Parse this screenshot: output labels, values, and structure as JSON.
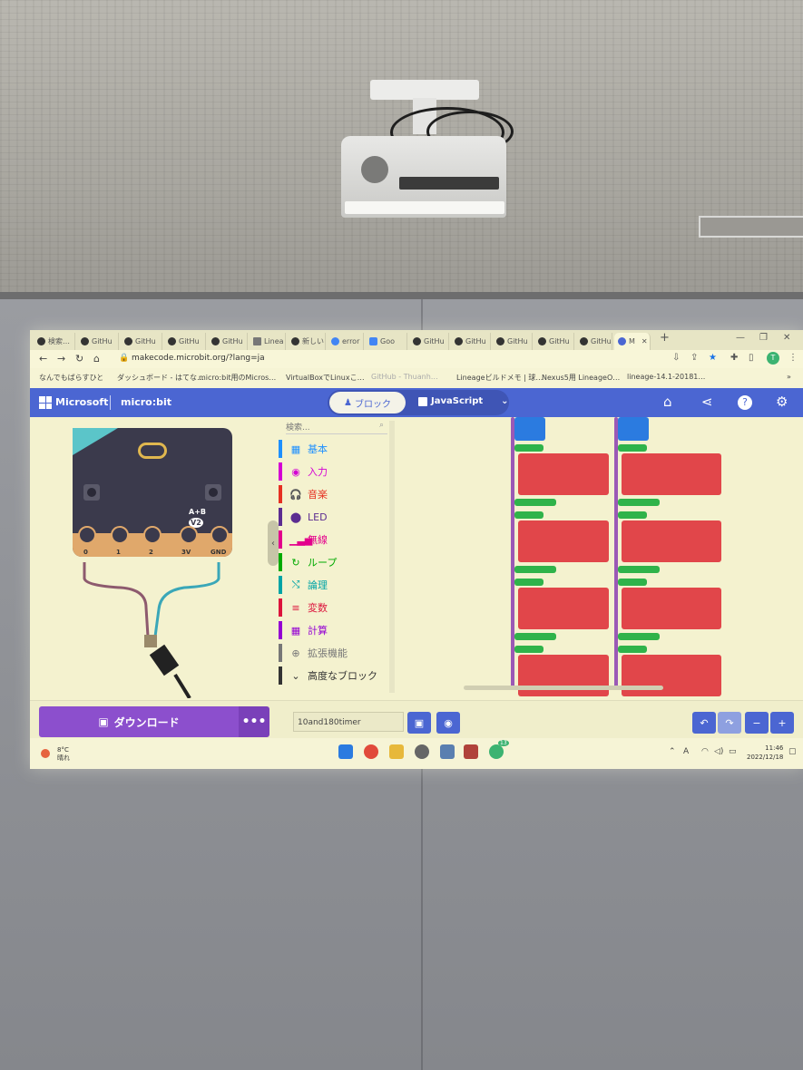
{
  "browser": {
    "tabs": [
      "検索…",
      "GitHu",
      "GitHu",
      "GitHu",
      "GitHu",
      "Linea",
      "新しい",
      "error",
      "Goo",
      "GitHu",
      "GitHu",
      "GitHu",
      "GitHu",
      "GitHu",
      "M"
    ],
    "new_tab": "+",
    "url": "makecode.microbit.org/?lang=ja",
    "bookmarks": [
      "なんでもばらすひと",
      "ダッシュボード - はてな…",
      "micro:bit用のMicros…",
      "VirtualBoxでLinuxこ…",
      "GitHub - Thuanh…",
      "Lineageビルドメモ | 球…",
      "Nexus5用 LineageO…",
      "lineage-14.1-20181…"
    ]
  },
  "makecode": {
    "brand": "Microsoft",
    "product": "micro:bit",
    "blocks_label": "ブロック",
    "js_label": "JavaScript",
    "search_placeholder": "検索...",
    "categories": [
      {
        "label": "基本",
        "color": "#1e90ff",
        "icon": "grid-icon"
      },
      {
        "label": "入力",
        "color": "#d400d4",
        "icon": "target-icon"
      },
      {
        "label": "音楽",
        "color": "#e63022",
        "icon": "headphones-icon"
      },
      {
        "label": "LED",
        "color": "#5c2d91",
        "icon": "toggle-icon"
      },
      {
        "label": "無線",
        "color": "#e3008c",
        "icon": "signal-icon"
      },
      {
        "label": "ループ",
        "color": "#00aa00",
        "icon": "loop-icon"
      },
      {
        "label": "論理",
        "color": "#00a4a6",
        "icon": "shuffle-icon"
      },
      {
        "label": "変数",
        "color": "#dc143c",
        "icon": "list-icon"
      },
      {
        "label": "計算",
        "color": "#9400d3",
        "icon": "calculator-icon"
      },
      {
        "label": "拡張機能",
        "color": "#777777",
        "icon": "plus-icon"
      },
      {
        "label": "高度なブロック",
        "color": "#333333",
        "icon": "chevron-down-icon"
      }
    ],
    "download_label": "ダウンロード",
    "more_label": "•••",
    "project_name": "10and180timer",
    "simulator": {
      "pins": [
        "0",
        "1",
        "2",
        "3V",
        "GND"
      ],
      "ab_label": "A+B",
      "version": "V2"
    }
  },
  "taskbar": {
    "temperature": "8°C",
    "weather": "晴れ",
    "time": "11:46",
    "date": "2022/12/18",
    "badge": "13"
  }
}
